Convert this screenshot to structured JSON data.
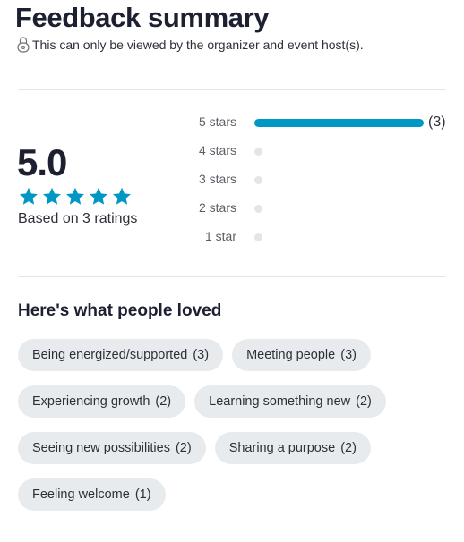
{
  "header": {
    "title": "Feedback summary",
    "privacy_note": "This can only be viewed by the organizer and event host(s)."
  },
  "rating": {
    "score": "5.0",
    "stars_filled": 5,
    "stars_total": 5,
    "based_on": "Based on 3 ratings",
    "star_color": "#0097c4"
  },
  "distribution": [
    {
      "label": "5 stars",
      "count": "(3)",
      "fraction": 1.0
    },
    {
      "label": "4 stars",
      "count": "",
      "fraction": 0
    },
    {
      "label": "3 stars",
      "count": "",
      "fraction": 0
    },
    {
      "label": "2 stars",
      "count": "",
      "fraction": 0
    },
    {
      "label": "1 star",
      "count": "",
      "fraction": 0
    }
  ],
  "loved": {
    "title": "Here's what people loved",
    "tags": [
      {
        "label": "Being energized/supported",
        "count": "(3)"
      },
      {
        "label": "Meeting people",
        "count": "(3)"
      },
      {
        "label": "Experiencing growth",
        "count": "(2)"
      },
      {
        "label": "Learning something new",
        "count": "(2)"
      },
      {
        "label": "Seeing new possibilities",
        "count": "(2)"
      },
      {
        "label": "Sharing a purpose",
        "count": "(2)"
      },
      {
        "label": "Feeling welcome",
        "count": "(1)"
      }
    ]
  },
  "icons": {
    "privacy": "lock-icon",
    "star": "star-icon"
  }
}
